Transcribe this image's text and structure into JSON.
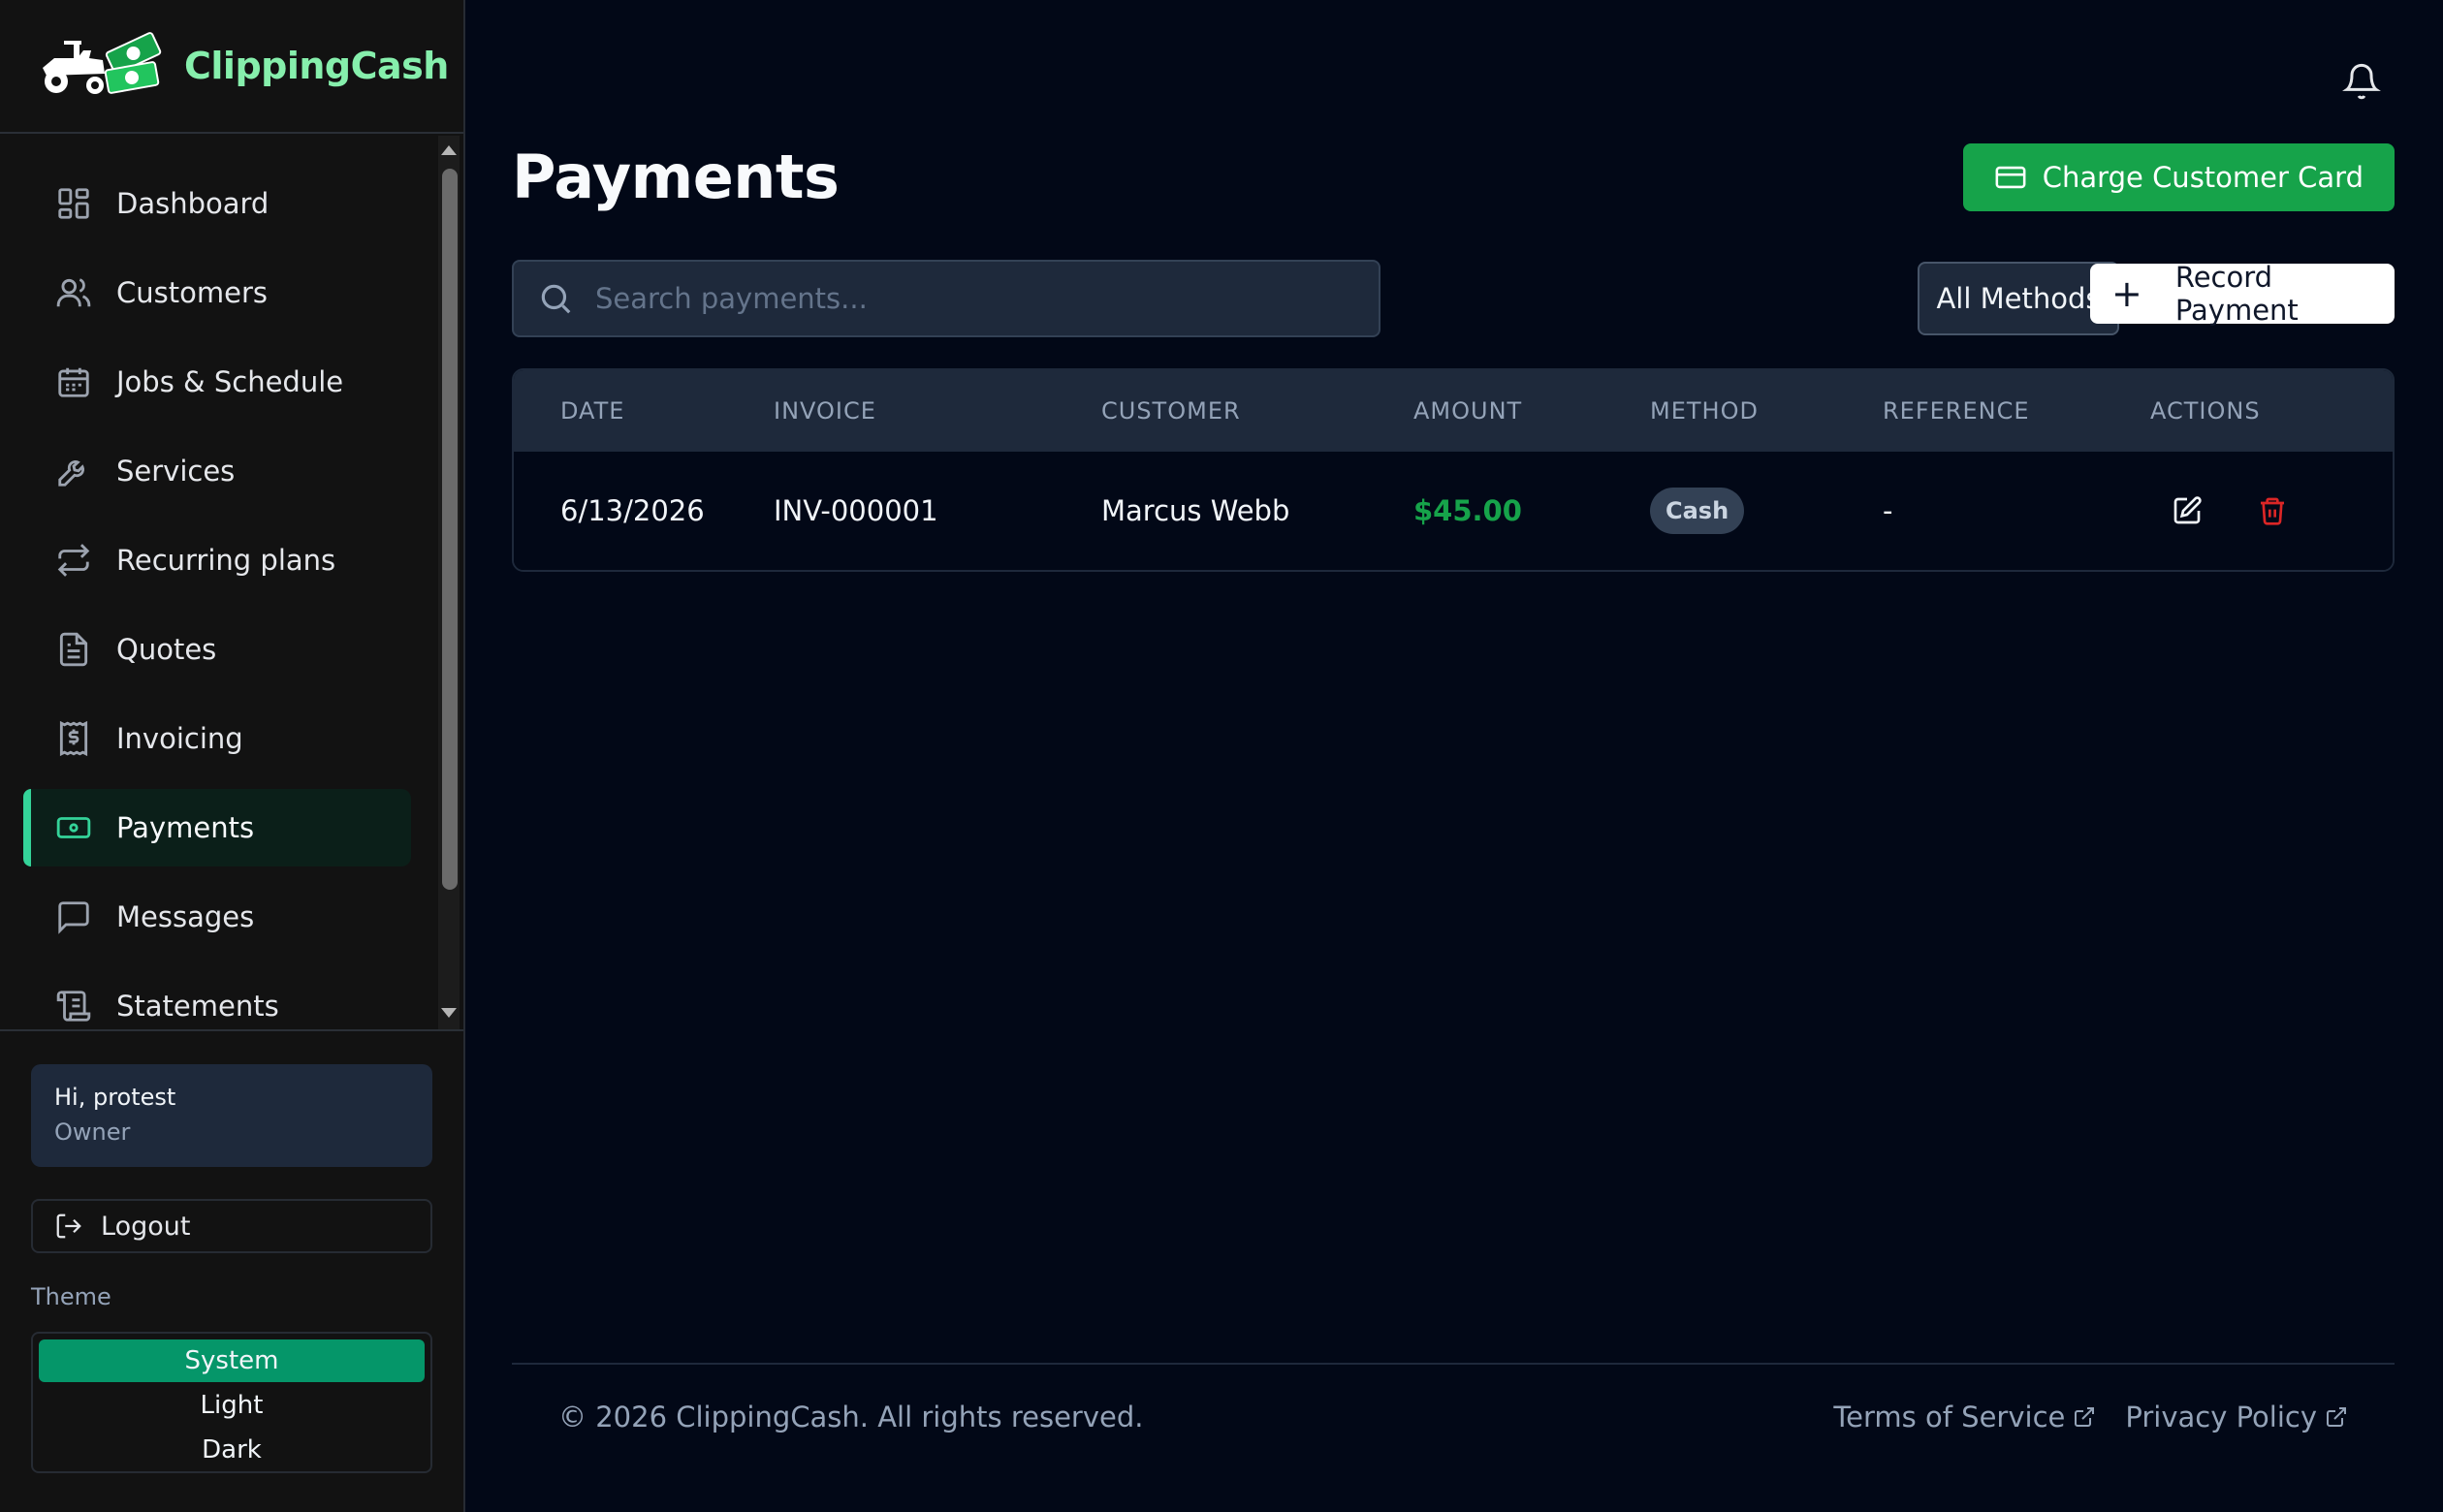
{
  "brand": {
    "name": "ClippingCash"
  },
  "nav": {
    "items": [
      {
        "label": "Dashboard",
        "icon": "dashboard-icon"
      },
      {
        "label": "Customers",
        "icon": "users-icon"
      },
      {
        "label": "Jobs & Schedule",
        "icon": "calendar-icon"
      },
      {
        "label": "Services",
        "icon": "wrench-icon"
      },
      {
        "label": "Recurring plans",
        "icon": "repeat-icon"
      },
      {
        "label": "Quotes",
        "icon": "document-icon"
      },
      {
        "label": "Invoicing",
        "icon": "receipt-icon"
      },
      {
        "label": "Payments",
        "icon": "banknote-icon",
        "active": true
      },
      {
        "label": "Messages",
        "icon": "message-icon"
      },
      {
        "label": "Statements",
        "icon": "scroll-icon"
      }
    ]
  },
  "user": {
    "greeting": "Hi, protest",
    "role": "Owner"
  },
  "logout": {
    "label": "Logout"
  },
  "theme": {
    "label": "Theme",
    "options": [
      "System",
      "Light",
      "Dark"
    ],
    "selected": "System"
  },
  "page": {
    "title": "Payments"
  },
  "toolbar": {
    "charge_label": "Charge Customer Card",
    "search_placeholder": "Search payments...",
    "methods_label": "All Methods",
    "record_label": "Record Payment"
  },
  "table": {
    "columns": [
      "Date",
      "Invoice",
      "Customer",
      "Amount",
      "Method",
      "Reference",
      "Actions"
    ],
    "rows": [
      {
        "date": "6/13/2026",
        "invoice": "INV-000001",
        "customer": "Marcus Webb",
        "amount": "$45.00",
        "method": "Cash",
        "reference": "-"
      }
    ]
  },
  "footer": {
    "copyright": "© 2026 ClippingCash. All rights reserved.",
    "terms": "Terms of Service",
    "privacy": "Privacy Policy"
  },
  "colors": {
    "accent": "#16a34a",
    "active_nav": "#34d399",
    "danger": "#dc2626",
    "background": "#020817"
  }
}
